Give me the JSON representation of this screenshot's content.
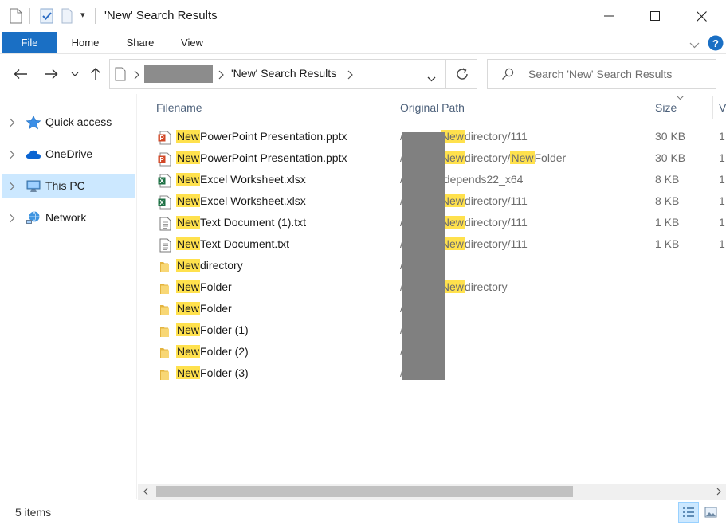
{
  "window": {
    "title": "'New' Search Results",
    "quick_access_dropdown": "▾"
  },
  "ribbon": {
    "tabs": [
      "File",
      "Home",
      "Share",
      "View"
    ]
  },
  "address": {
    "crumb": "'New' Search Results"
  },
  "search": {
    "placeholder": "Search 'New' Search Results"
  },
  "sidebar": {
    "items": [
      {
        "label": "Quick access",
        "icon": "star-icon"
      },
      {
        "label": "OneDrive",
        "icon": "cloud-icon"
      },
      {
        "label": "This PC",
        "icon": "computer-icon",
        "selected": true
      },
      {
        "label": "Network",
        "icon": "network-icon"
      }
    ]
  },
  "columns": {
    "filename": "Filename",
    "path": "Original Path",
    "size": "Size",
    "extra": "V"
  },
  "rows": [
    {
      "highlight": "New",
      "rest": "PowerPoint Presentation.pptx",
      "path_a": "/",
      "path_hl": "New",
      "path_b": "directory/111",
      "path_hl2": "",
      "path_c": "",
      "size": "30 KB",
      "extra": "1",
      "icon": "powerpoint-icon"
    },
    {
      "highlight": "New",
      "rest": "PowerPoint Presentation.pptx",
      "path_a": "/",
      "path_hl": "New",
      "path_b": "directory/",
      "path_hl2": "New",
      "path_c": "Folder",
      "size": "30 KB",
      "extra": "1",
      "icon": "powerpoint-icon"
    },
    {
      "highlight": "New",
      "rest": "Excel Worksheet.xlsx",
      "path_a": "/",
      "path_hl": "",
      "path_b": "/depends22_x64",
      "path_hl2": "",
      "path_c": "",
      "size": "8 KB",
      "extra": "1",
      "icon": "excel-icon"
    },
    {
      "highlight": "New",
      "rest": "Excel Worksheet.xlsx",
      "path_a": "/",
      "path_hl": "New",
      "path_b": "directory/111",
      "path_hl2": "",
      "path_c": "",
      "size": "8 KB",
      "extra": "1",
      "icon": "excel-icon"
    },
    {
      "highlight": "New",
      "rest": "Text Document (1).txt",
      "path_a": "/",
      "path_hl": "New",
      "path_b": "directory/111",
      "path_hl2": "",
      "path_c": "",
      "size": "1 KB",
      "extra": "1",
      "icon": "text-file-icon"
    },
    {
      "highlight": "New",
      "rest": "Text Document.txt",
      "path_a": "/",
      "path_hl": "New",
      "path_b": "directory/111",
      "path_hl2": "",
      "path_c": "",
      "size": "1 KB",
      "extra": "1",
      "icon": "text-file-icon"
    },
    {
      "highlight": "New",
      "rest": "directory",
      "path_a": "/",
      "path_hl": "",
      "path_b": "",
      "path_hl2": "",
      "path_c": "",
      "size": "",
      "extra": "",
      "icon": "folder-icon"
    },
    {
      "highlight": "New",
      "rest": "Folder",
      "path_a": "/",
      "path_hl": "New",
      "path_b": "directory",
      "path_hl2": "",
      "path_c": "",
      "size": "",
      "extra": "",
      "icon": "folder-icon"
    },
    {
      "highlight": "New",
      "rest": "Folder",
      "path_a": "/",
      "path_hl": "",
      "path_b": "",
      "path_hl2": "",
      "path_c": "",
      "size": "",
      "extra": "",
      "icon": "folder-icon"
    },
    {
      "highlight": "New",
      "rest": "Folder (1)",
      "path_a": "/",
      "path_hl": "",
      "path_b": "",
      "path_hl2": "",
      "path_c": "",
      "size": "",
      "extra": "",
      "icon": "folder-icon"
    },
    {
      "highlight": "New",
      "rest": "Folder (2)",
      "path_a": "/",
      "path_hl": "",
      "path_b": "",
      "path_hl2": "",
      "path_c": "",
      "size": "",
      "extra": "",
      "icon": "folder-icon"
    },
    {
      "highlight": "New",
      "rest": "Folder (3)",
      "path_a": "/",
      "path_hl": "",
      "path_b": "",
      "path_hl2": "",
      "path_c": "",
      "size": "",
      "extra": "",
      "icon": "folder-icon"
    }
  ],
  "status": {
    "items": "5 items"
  },
  "colors": {
    "accent": "#1a6fc4",
    "highlight": "#ffe14d",
    "selected": "#cce8ff"
  }
}
